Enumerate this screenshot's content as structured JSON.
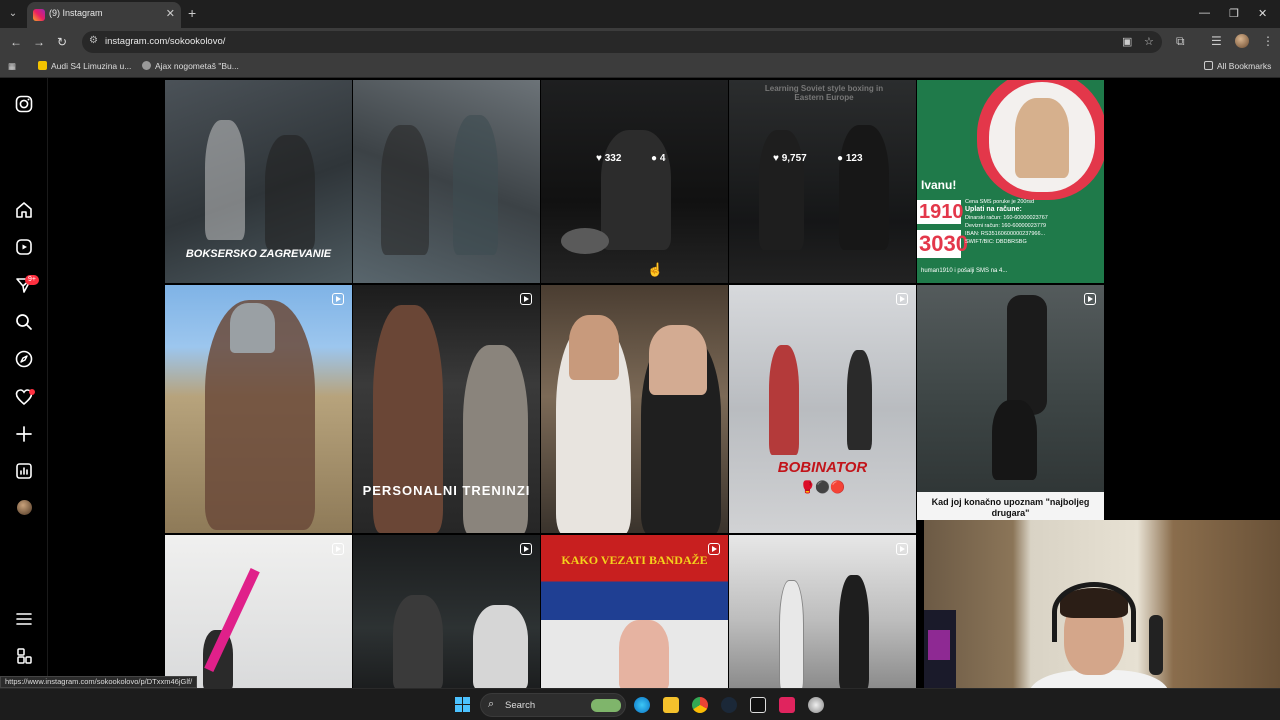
{
  "browser": {
    "tab_title": "(9) Instagram",
    "url": "instagram.com/sokookolovo/",
    "bookmarks": [
      "Audi S4 Limuzina u...",
      "Ajax nogometaš \"Bu..."
    ],
    "all_bookmarks": "All Bookmarks",
    "status_url": "https://www.instagram.com/sokookolovo/p/DTxxm46jGlf/"
  },
  "sidebar": {
    "notification_badge": "9+"
  },
  "posts": [
    {
      "caption": "BOKSERSKO ZAGREVANIE"
    },
    {
      "caption": ""
    },
    {
      "likes": "332",
      "comments": "4"
    },
    {
      "caption": "Learning Soviet style boxing in Eastern Europe",
      "likes": "9,757",
      "comments": "123"
    },
    {
      "caption": "Ivanu!",
      "lines": [
        "1910",
        "3030"
      ],
      "detail_lines": [
        "Cena SMS poruke je 200rsd",
        "Uplati na račune:",
        "Dinarski račun: 160-60000023767",
        "Devizni račun: 160-60000023779",
        "IBAN: RS35160600000237966...",
        "SWIFT/BIC: DBDBRSBG"
      ],
      "footer": "human1910 i pošalji SMS na 4..."
    },
    {
      "caption": ""
    },
    {
      "caption": "PERSONALNI TRENINZI"
    },
    {
      "caption": ""
    },
    {
      "caption": "BOBINATOR"
    },
    {
      "caption": "Kad joj konačno upoznam \"najboljeg drugara\""
    },
    {
      "caption": ""
    },
    {
      "caption": ""
    },
    {
      "caption": "KAKO VEZATI BANDAŽE"
    },
    {
      "caption": ""
    }
  ],
  "taskbar": {
    "search_label": "Search"
  },
  "icons": {
    "instagram": "instagram-logo-icon",
    "home": "home-icon",
    "reels": "reels-icon",
    "messages": "messages-icon",
    "search": "search-icon",
    "explore": "explore-icon",
    "notifications": "heart-icon",
    "create": "plus-icon",
    "dashboard": "dashboard-icon",
    "more": "menu-icon",
    "also_from_meta": "meta-apps-icon"
  }
}
